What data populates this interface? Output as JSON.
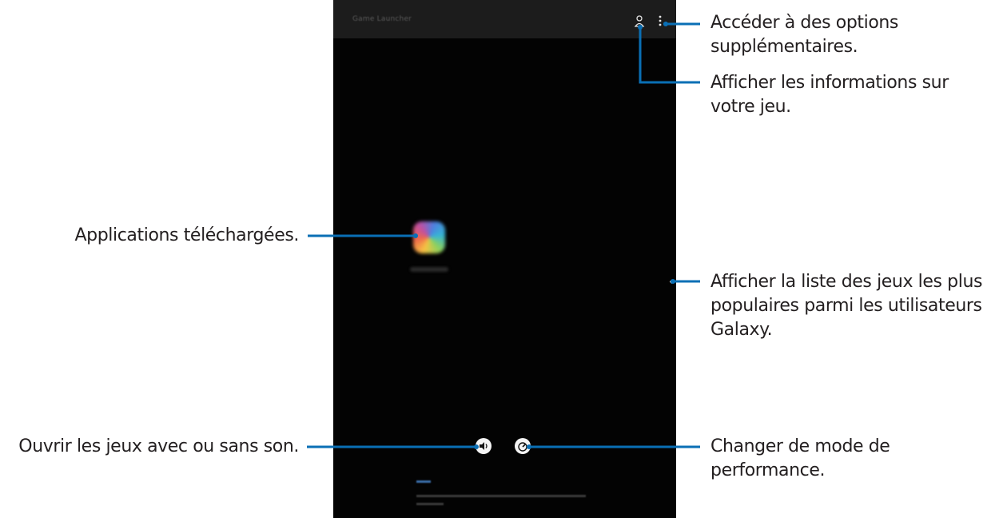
{
  "screen": {
    "app_title": "Game Launcher",
    "icons": [
      "profile-icon",
      "more-options-icon",
      "app-icon",
      "chevron-left-icon",
      "sound-icon",
      "performance-icon"
    ]
  },
  "callouts": {
    "more_options": {
      "line1": "Accéder à des options",
      "line2": "supplémentaires."
    },
    "game_info": {
      "line1": "Afficher les informations sur",
      "line2": "votre jeu."
    },
    "downloaded_apps": {
      "line1": "Applications téléchargées."
    },
    "popular_games": {
      "line1": "Afficher la liste des jeux les plus",
      "line2": "populaires parmi les utilisateurs",
      "line3": "Galaxy."
    },
    "sound": {
      "line1": "Ouvrir les jeux avec ou sans son."
    },
    "performance": {
      "line1": "Changer de mode de",
      "line2": "performance."
    }
  },
  "colors": {
    "accent_line": "#0a6fb5",
    "screen_bg": "#030303",
    "topbar_bg": "#1c1c1c"
  }
}
